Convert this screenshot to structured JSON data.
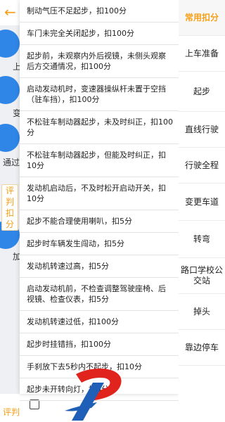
{
  "background": {
    "back_icon": "arrow-left-icon",
    "labels": [
      "上",
      "变",
      "通过",
      "加"
    ],
    "score_tab_label": "评\n判\n扣\n分",
    "score_tab_bottom_label": "评判",
    "check_label": ""
  },
  "deductions": [
    "制动气压不足起步，扣100分",
    "车门未完全关闭起步，扣100分",
    "起步前，未观察内外后视镜，未侧头观察后方交通情况，扣100分",
    "启动发动机时，变速器操纵杆未置于空挡（驻车挡），扣100分",
    "不松驻车制动器起步，未及时纠正，扣100分",
    "不松驻车制动器起步，但能及时纠正，扣10分",
    "发动机启动后，不及时松开启动开关，扣10分",
    "起步不能合理使用喇叭，扣5分",
    "起步时车辆发生闯动，扣5分",
    "发动机转速过高，扣5分",
    "启动发动机前，不检查调整驾驶座椅、后视镜、检查仪表，扣5分",
    "发动机转速过低，扣100分",
    "起步时挂错挡，扣100分",
    "手刹放下去5秒内不起步，扣10分",
    "起步未开转向灯，扣5分"
  ],
  "categories": [
    "常用扣分",
    "上车准备",
    "起步",
    "直线行驶",
    "行驶全程",
    "变更车道",
    "转弯",
    "路口学校公交站",
    "掉头",
    "靠边停车"
  ],
  "active_category": "常用扣分",
  "colors": {
    "accent": "#f5a017",
    "circle": "#2f86e6",
    "logo_red": "#e0231c",
    "logo_blue": "#1f5fb8"
  }
}
